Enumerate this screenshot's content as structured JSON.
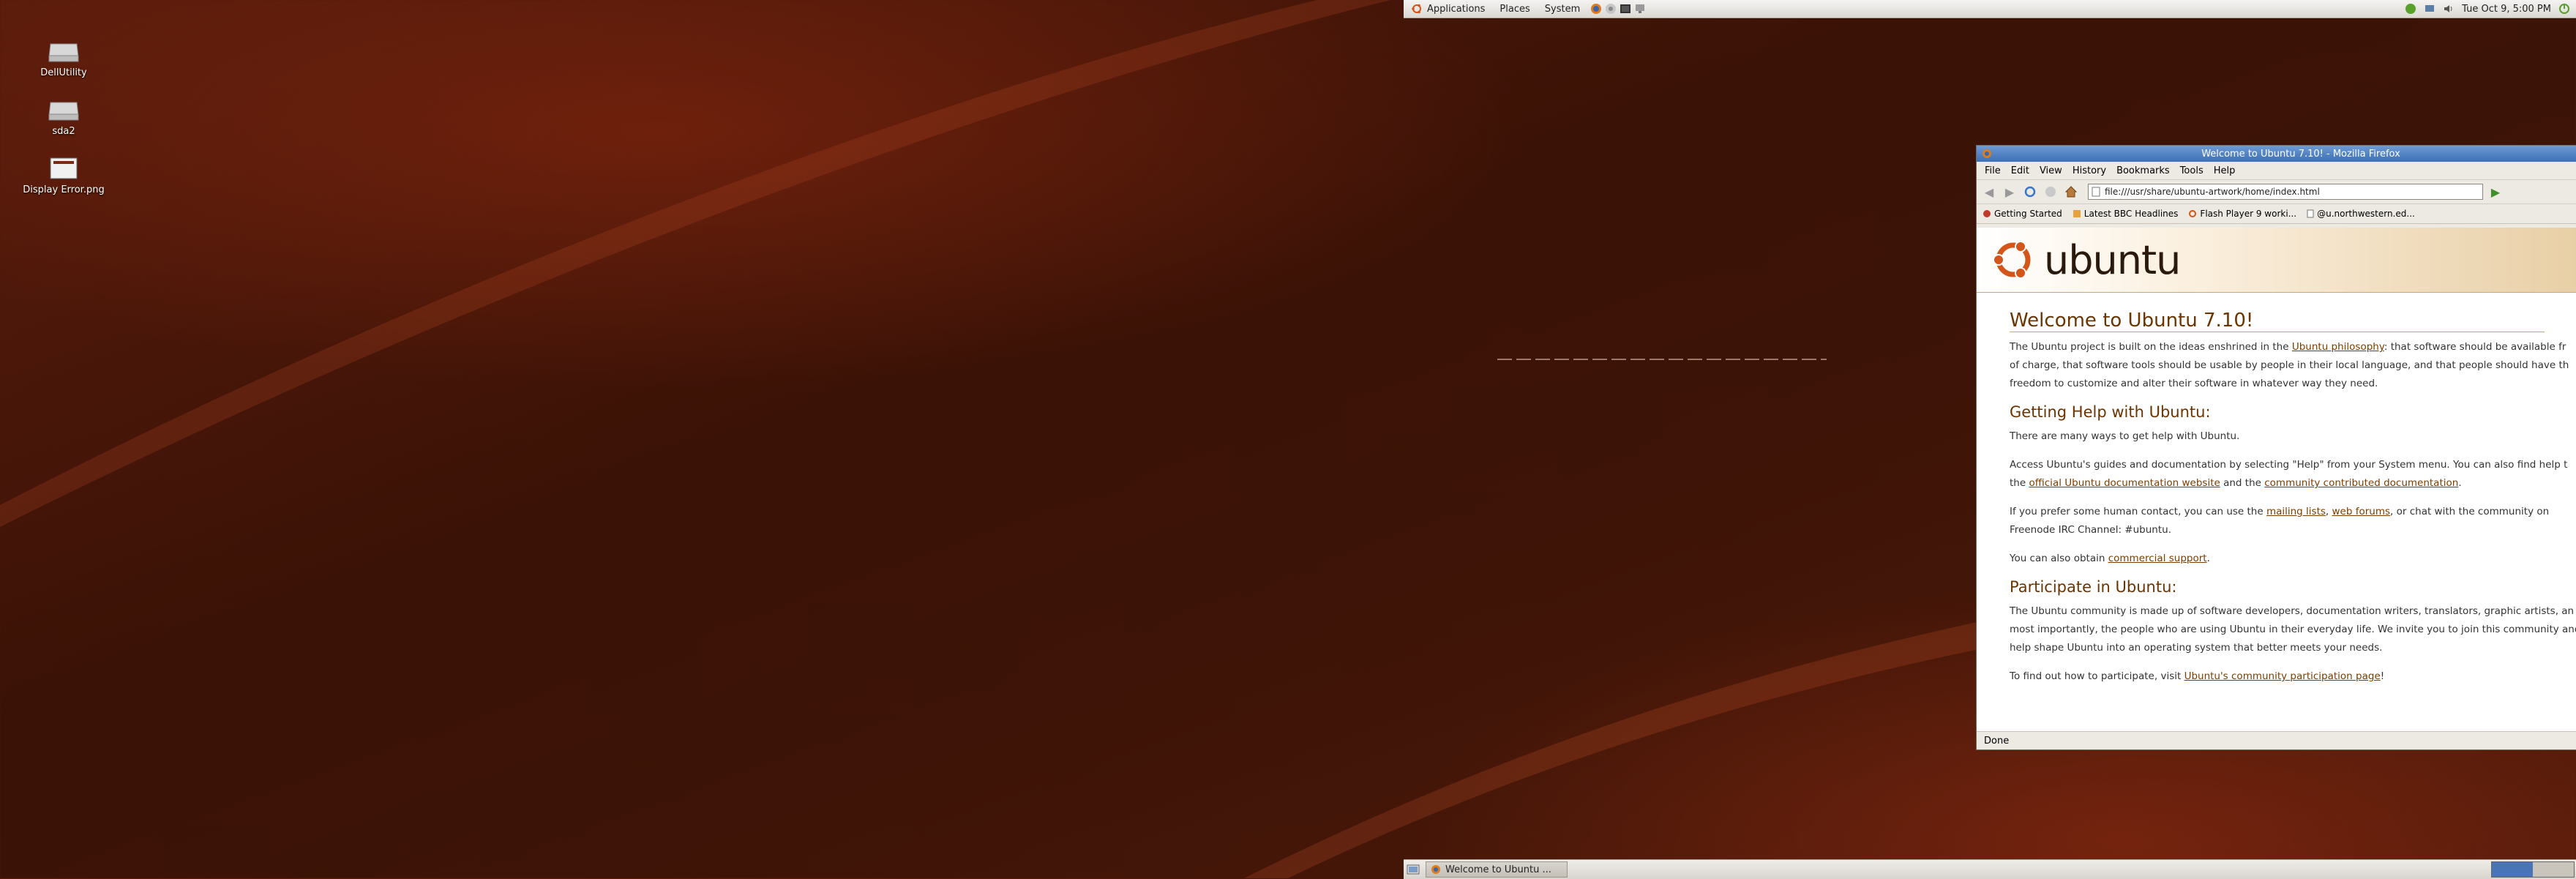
{
  "top_panel": {
    "menus": [
      "Applications",
      "Places",
      "System"
    ],
    "clock": "Tue Oct  9,  5:00 PM"
  },
  "desktop": {
    "icons": [
      {
        "label": "DellUtility",
        "icon": "drive-icon"
      },
      {
        "label": "sda2",
        "icon": "drive-icon"
      },
      {
        "label": "Display Error.png",
        "icon": "image-file-icon"
      }
    ]
  },
  "firefox": {
    "title": "Welcome to Ubuntu 7.10! - Mozilla Firefox",
    "menus": [
      "File",
      "Edit",
      "View",
      "History",
      "Bookmarks",
      "Tools",
      "Help"
    ],
    "url": "file:///usr/share/ubuntu-artwork/home/index.html",
    "bookmarks": [
      "Getting Started",
      "Latest BBC Headlines",
      "Flash Player 9 worki...",
      "@u.northwestern.ed..."
    ],
    "status": "Done"
  },
  "page": {
    "logo": "ubuntu",
    "heading": "Welcome to Ubuntu 7.10!",
    "p1_a": "The Ubuntu project is built on the ideas enshrined in the ",
    "p1_link": "Ubuntu philosophy",
    "p1_b": ": that software should be available fr",
    "p1_line2": "of charge, that software tools should be usable by people in their local language, and that people should have th",
    "p1_line3": "freedom to customize and alter their software in whatever way they need.",
    "h_help": "Getting Help with Ubuntu:",
    "p2": "There are many ways to get help with Ubuntu.",
    "p3_line1": "Access Ubuntu's guides and documentation by selecting \"Help\" from your System menu. You can also find help t",
    "p3_pre": "the ",
    "p3_link1": "official Ubuntu documentation website",
    "p3_mid": " and the ",
    "p3_link2": "community contributed documentation",
    "p3_end": ".",
    "p4_pre": "If you prefer some human contact, you can use the ",
    "p4_link1": "mailing lists",
    "p4_comma": ", ",
    "p4_link2": "web forums",
    "p4_post": ", or chat with the community on",
    "p4_line2": "Freenode IRC Channel: #ubuntu.",
    "p5_pre": "You can also obtain ",
    "p5_link": "commercial support",
    "p5_end": ".",
    "h_participate": "Participate in Ubuntu:",
    "p6_line1": "The Ubuntu community is made up of software developers, documentation writers, translators, graphic artists, an",
    "p6_line2": "most importantly, the people who are using Ubuntu in their everyday life. We invite you to join this community and",
    "p6_line3": "help shape Ubuntu into an operating system that better meets your needs.",
    "p7_pre": "To find out how to participate, visit ",
    "p7_link": "Ubuntu's community participation page",
    "p7_end": "!"
  },
  "bottom_panel": {
    "task_label": "Welcome to Ubuntu ..."
  },
  "colors": {
    "accent_link": "#7a3d00",
    "heading": "#6b3400",
    "titlebar": "#3c6fb5"
  }
}
